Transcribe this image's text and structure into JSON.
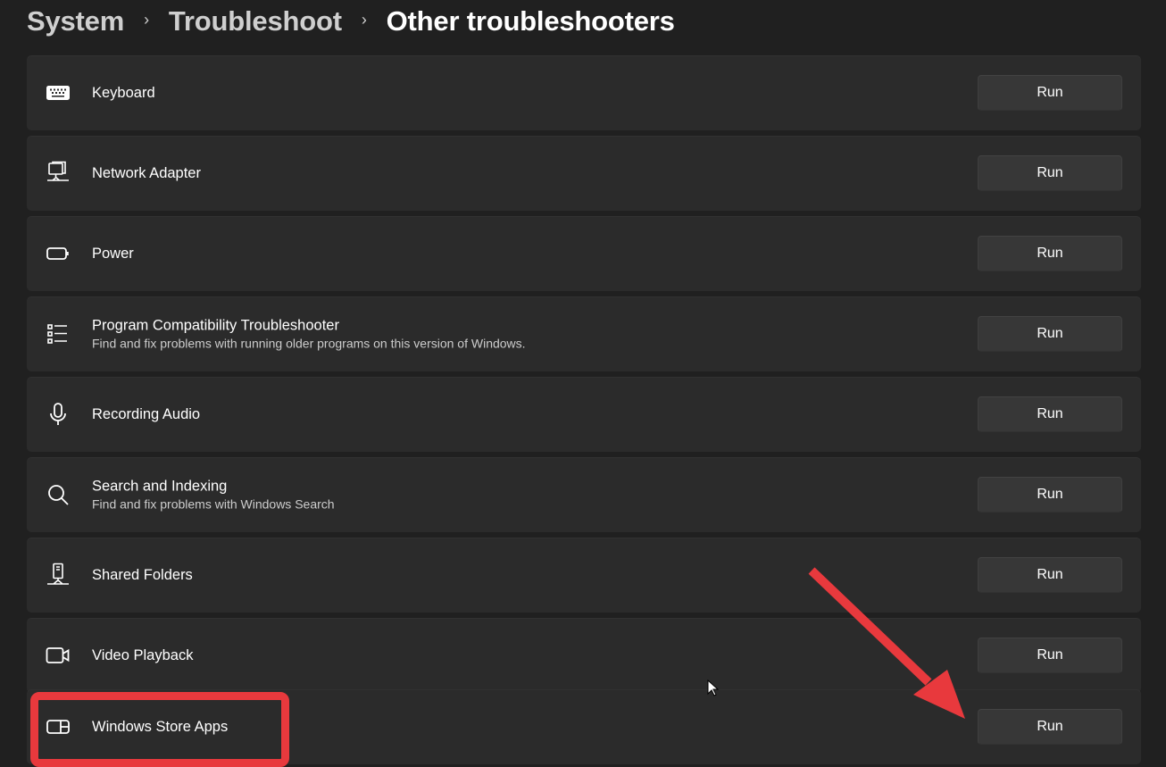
{
  "breadcrumb": {
    "items": [
      "System",
      "Troubleshoot",
      "Other troubleshooters"
    ],
    "separator": "›"
  },
  "troubleshooters": [
    {
      "title": "Keyboard",
      "description": "",
      "icon": "keyboard-icon",
      "button": "Run"
    },
    {
      "title": "Network Adapter",
      "description": "",
      "icon": "network-adapter-icon",
      "button": "Run"
    },
    {
      "title": "Power",
      "description": "",
      "icon": "battery-icon",
      "button": "Run"
    },
    {
      "title": "Program Compatibility Troubleshooter",
      "description": "Find and fix problems with running older programs on this version of Windows.",
      "icon": "list-icon",
      "button": "Run"
    },
    {
      "title": "Recording Audio",
      "description": "",
      "icon": "microphone-icon",
      "button": "Run"
    },
    {
      "title": "Search and Indexing",
      "description": "Find and fix problems with Windows Search",
      "icon": "search-icon",
      "button": "Run"
    },
    {
      "title": "Shared Folders",
      "description": "",
      "icon": "shared-folders-icon",
      "button": "Run"
    },
    {
      "title": "Video Playback",
      "description": "",
      "icon": "video-camera-icon",
      "button": "Run"
    },
    {
      "title": "Windows Store Apps",
      "description": "",
      "icon": "store-apps-icon",
      "button": "Run"
    }
  ],
  "annotations": {
    "highlighted_item": "Windows Store Apps",
    "highlight_color": "#e8393d",
    "arrow_target": "Windows Store Apps Run button"
  }
}
